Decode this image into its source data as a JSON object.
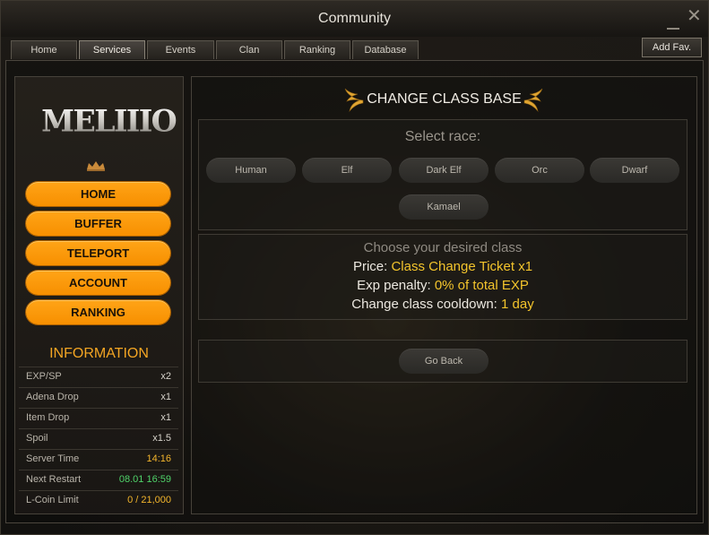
{
  "window": {
    "title": "Community"
  },
  "tabs": [
    {
      "label": "Home"
    },
    {
      "label": "Services",
      "active": true
    },
    {
      "label": "Events"
    },
    {
      "label": "Clan"
    },
    {
      "label": "Ranking"
    },
    {
      "label": "Database"
    }
  ],
  "add_fav_label": "Add Fav.",
  "logo_text": "MELIIIOR",
  "sidebar": {
    "menu": [
      {
        "label": "HOME"
      },
      {
        "label": "BUFFER"
      },
      {
        "label": "TELEPORT"
      },
      {
        "label": "ACCOUNT"
      },
      {
        "label": "RANKING"
      }
    ],
    "info_title": "INFORMATION",
    "info_rows": [
      {
        "label": "EXP/SP",
        "value": "x2",
        "color": "#d8d4cc"
      },
      {
        "label": "Adena Drop",
        "value": "x1",
        "color": "#d8d4cc"
      },
      {
        "label": "Item Drop",
        "value": "x1",
        "color": "#d8d4cc"
      },
      {
        "label": "Spoil",
        "value": "x1.5",
        "color": "#d8d4cc"
      },
      {
        "label": "Server Time",
        "value": "14:16",
        "color": "#f3b52c"
      },
      {
        "label": "Next Restart",
        "value": "08.01 16:59",
        "color": "#4fd36a"
      },
      {
        "label": "L-Coin Limit",
        "value": "0 / 21,000",
        "color": "#f3b52c"
      }
    ]
  },
  "main": {
    "heading": "CHANGE CLASS BASE",
    "select_race_label": "Select race:",
    "races": [
      "Human",
      "Elf",
      "Dark Elf",
      "Orc",
      "Dwarf",
      "Kamael"
    ],
    "choose_label": "Choose your desired class",
    "price_label": "Price:",
    "price_value": "Class Change Ticket x1",
    "exp_label": "Exp penalty:",
    "exp_value": "0% of total EXP",
    "cooldown_label": "Change class cooldown:",
    "cooldown_value": "1 day",
    "go_back_label": "Go Back"
  },
  "colors": {
    "accent_orange": "#f7990f",
    "gold_text": "#f3c42c"
  }
}
